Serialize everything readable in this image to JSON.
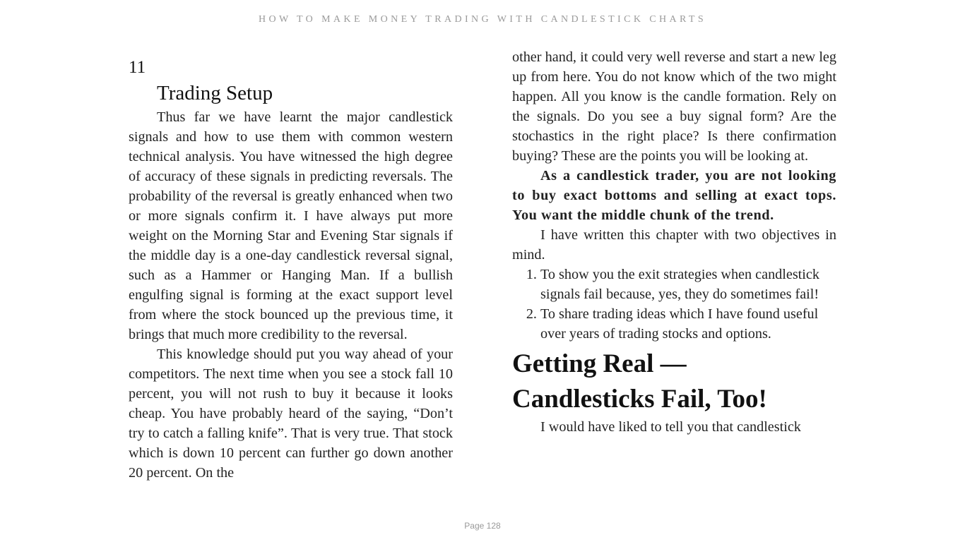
{
  "header": {
    "book_title": "HOW TO MAKE MONEY TRADING WITH CANDLESTICK CHARTS"
  },
  "left_page": {
    "chapter_number": "11",
    "chapter_title": "Trading Setup",
    "paragraphs": [
      "Thus far we have learnt the major candlestick signals and how to use them with common western technical analysis. You have witnessed the high degree of accuracy of these signals in predicting reversals. The probability of the reversal is greatly enhanced when two or more signals confirm it. I have always put more weight on the Morning Star and Evening Star signals if the middle day is a one-day candlestick reversal signal, such as a Hammer or Hanging Man. If a bullish engulfing signal is forming at the exact support level from where the stock bounced up the previous time, it brings that much more credibility to the reversal.",
      "This knowledge should put you way ahead of your competitors. The next time when you see a stock fall 10 percent, you will not rush to buy it because it looks cheap. You have probably heard of the saying, “Don’t try to catch a falling knife”. That is very true. That stock which is down 10 percent can further go down another 20 percent. On the"
    ]
  },
  "right_page": {
    "continuation": "other hand, it could very well reverse and start a new leg up from here. You do not know which of the two might happen. All you know is the candle formation. Rely on the signals. Do you see a buy signal form? Are the stochastics in the right place? Is there confirmation buying? These are the points you will be looking at.",
    "bold_paragraph": "As a candlestick trader, you are not looking to buy exact bottoms and selling at exact tops. You want the middle chunk of the trend.",
    "objectives_intro": "I have written this chapter with two objectives in mind.",
    "objectives": [
      "To show you the exit strategies when candlestick signals fail because, yes, they do sometimes fail!",
      "To share trading ideas which I have found useful over years of trading stocks and options."
    ],
    "section_heading_line1": "Getting Real —",
    "section_heading_line2": "Candlesticks Fail, Too!",
    "last_paragraph": "I would have liked to tell you that candlestick"
  },
  "footer": {
    "page_label": "Page 128"
  }
}
